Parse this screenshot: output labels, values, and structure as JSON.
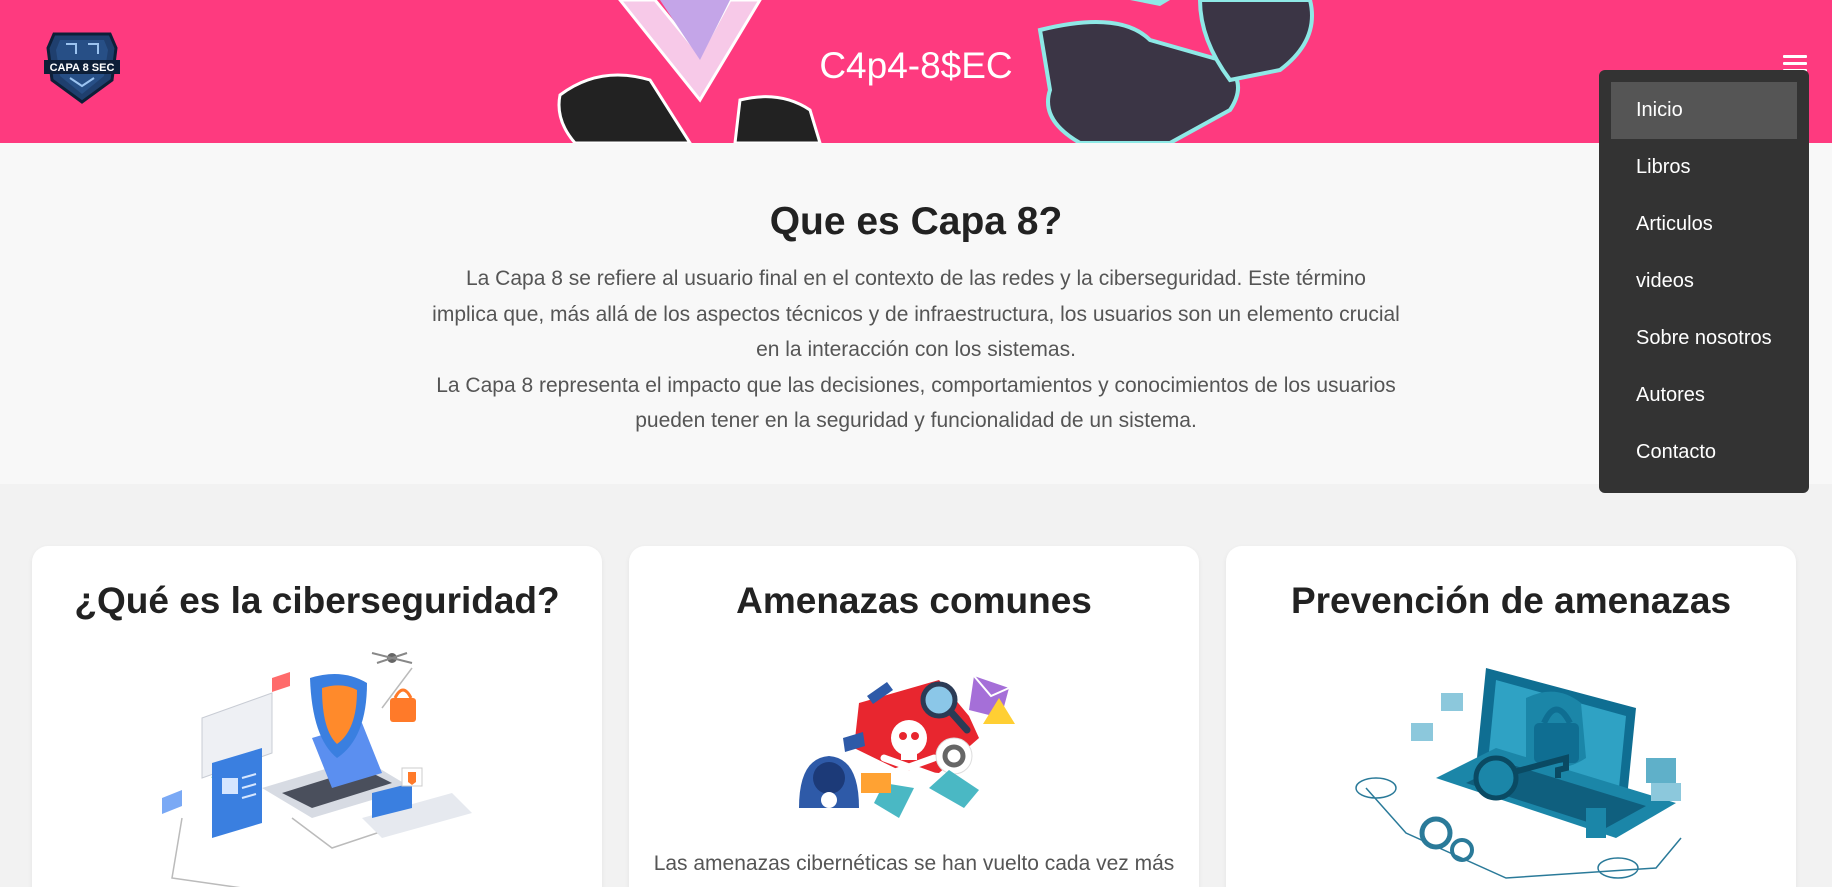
{
  "header": {
    "title": "C4p4-8$EC",
    "logo_text": "CAPA 8 SEC",
    "logo_icon": "shield-logo",
    "menu_icon": "hamburger-icon",
    "background_color": "#fe3a7f"
  },
  "intro": {
    "heading": "Que es Capa 8?",
    "paragraph1": "La Capa 8 se refiere al usuario final en el contexto de las redes y la ciberseguridad. Este término implica que, más allá de los aspectos técnicos y de infraestructura, los usuarios son un elemento crucial en la interacción con los sistemas.",
    "paragraph2": "La Capa 8 representa el impacto que las decisiones, comportamientos y conocimientos de los usuarios pueden tener en la seguridad y funcionalidad de un sistema."
  },
  "cards": [
    {
      "title": "¿Qué es la ciberseguridad?",
      "illustration": "cybersecurity-network-illustration",
      "text": ""
    },
    {
      "title": "Amenazas comunes",
      "illustration": "threats-skull-illustration",
      "text": "Las amenazas cibernéticas se han vuelto cada vez más"
    },
    {
      "title": "Prevención de amenazas",
      "illustration": "laptop-lock-illustration",
      "text": ""
    }
  ],
  "menu": {
    "items": [
      {
        "label": "Inicio",
        "active": true
      },
      {
        "label": "Libros"
      },
      {
        "label": "Articulos"
      },
      {
        "label": "videos"
      },
      {
        "label": "Sobre nosotros"
      },
      {
        "label": "Autores"
      },
      {
        "label": "Contacto"
      }
    ]
  }
}
